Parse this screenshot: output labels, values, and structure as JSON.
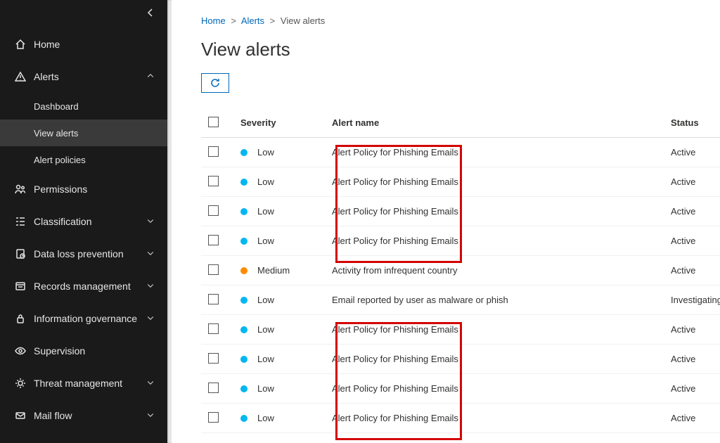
{
  "sidebar": {
    "home": "Home",
    "alerts": "Alerts",
    "alerts_subs": [
      "Dashboard",
      "View alerts",
      "Alert policies"
    ],
    "permissions": "Permissions",
    "classification": "Classification",
    "dlp": "Data loss prevention",
    "records": "Records management",
    "info_gov": "Information governance",
    "supervision": "Supervision",
    "threat": "Threat management",
    "mail": "Mail flow"
  },
  "breadcrumb": {
    "home": "Home",
    "alerts": "Alerts",
    "current": "View alerts"
  },
  "page_title": "View alerts",
  "columns": {
    "severity": "Severity",
    "name": "Alert name",
    "status": "Status"
  },
  "rows": [
    {
      "severity": "Low",
      "dot": "blue",
      "name": "Alert Policy for Phishing Emails",
      "status": "Active"
    },
    {
      "severity": "Low",
      "dot": "blue",
      "name": "Alert Policy for Phishing Emails",
      "status": "Active"
    },
    {
      "severity": "Low",
      "dot": "blue",
      "name": "Alert Policy for Phishing Emails",
      "status": "Active"
    },
    {
      "severity": "Low",
      "dot": "blue",
      "name": "Alert Policy for Phishing Emails",
      "status": "Active"
    },
    {
      "severity": "Medium",
      "dot": "orange",
      "name": "Activity from infrequent country",
      "status": "Active"
    },
    {
      "severity": "Low",
      "dot": "blue",
      "name": "Email reported by user as malware or phish",
      "status": "Investigating"
    },
    {
      "severity": "Low",
      "dot": "blue",
      "name": "Alert Policy for Phishing Emails",
      "status": "Active"
    },
    {
      "severity": "Low",
      "dot": "blue",
      "name": "Alert Policy for Phishing Emails",
      "status": "Active"
    },
    {
      "severity": "Low",
      "dot": "blue",
      "name": "Alert Policy for Phishing Emails",
      "status": "Active"
    },
    {
      "severity": "Low",
      "dot": "blue",
      "name": "Alert Policy for Phishing Emails",
      "status": "Active"
    }
  ]
}
